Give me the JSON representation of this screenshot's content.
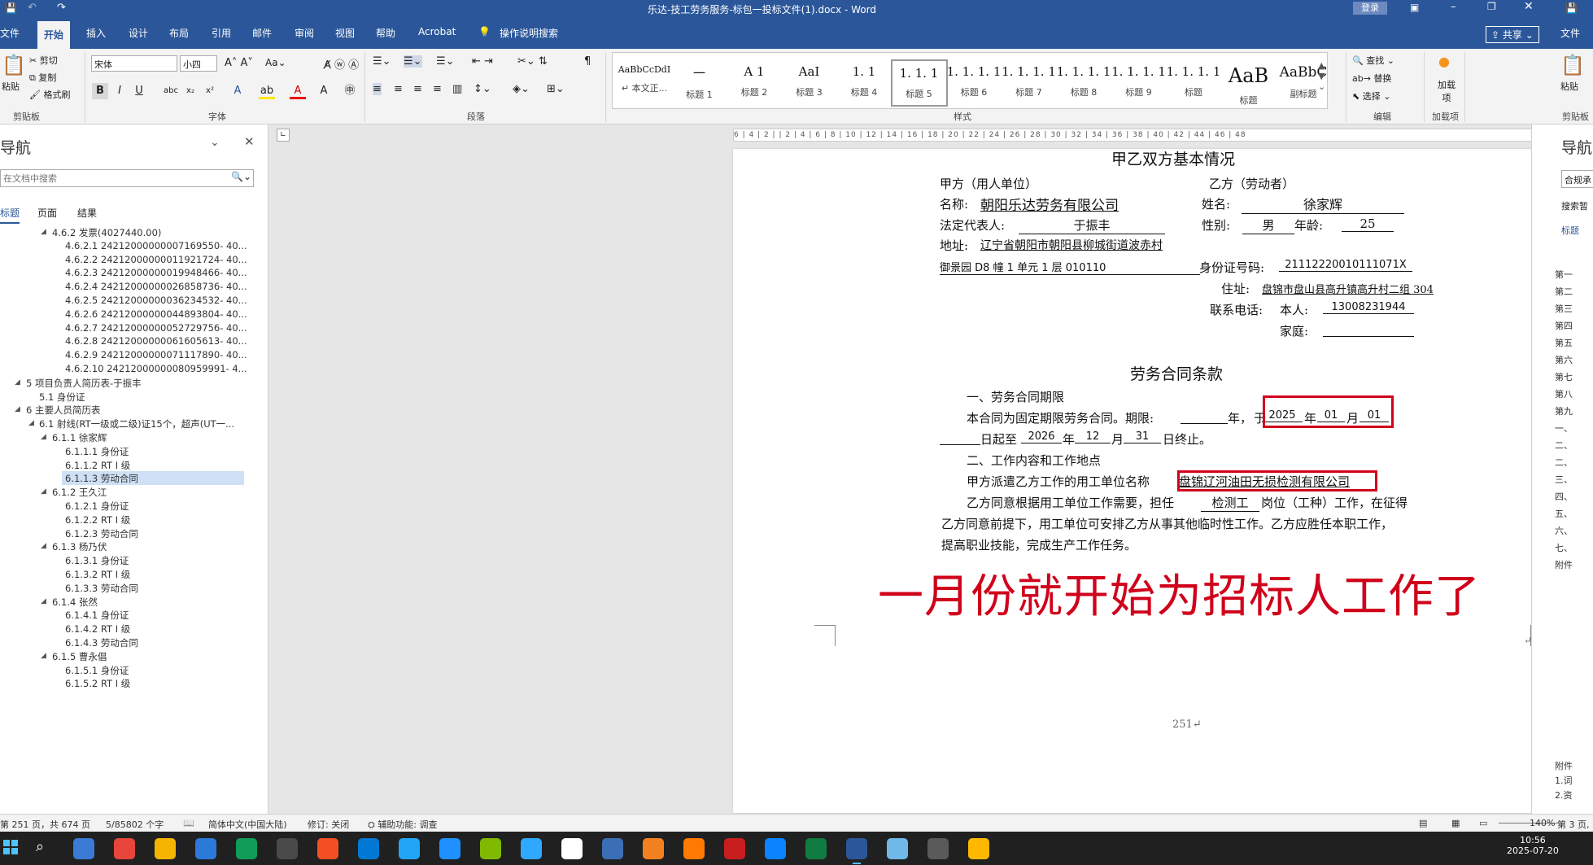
{
  "window": {
    "title": "乐达-技工劳务服务-标包一投标文件(1).docx  -  Word",
    "login": "登录",
    "share": "共享"
  },
  "tabs": [
    "文件",
    "开始",
    "插入",
    "设计",
    "布局",
    "引用",
    "邮件",
    "审阅",
    "视图",
    "帮助",
    "Acrobat"
  ],
  "search_tab": "操作说明搜索",
  "ribbon": {
    "clipboard": {
      "paste": "粘贴",
      "cut": "剪切",
      "copy": "复制",
      "format_painter": "格式刷",
      "group": "剪贴板"
    },
    "font": {
      "name": "宋体",
      "size": "小四",
      "group": "字体"
    },
    "paragraph": {
      "group": "段落"
    },
    "styles": {
      "group": "样式",
      "items": [
        {
          "preview": "AaBbCcDdI",
          "name": "↵ 本文正..."
        },
        {
          "preview": "一",
          "name": "标题 1"
        },
        {
          "preview": "A 1",
          "name": "标题 2"
        },
        {
          "preview": "AaI",
          "name": "标题 3"
        },
        {
          "preview": "1. 1",
          "name": "标题 4"
        },
        {
          "preview": "1. 1. 1",
          "name": "标题 5"
        },
        {
          "preview": "1. 1. 1. 1",
          "name": "标题 6"
        },
        {
          "preview": "1. 1. 1. 1",
          "name": "标题 7"
        },
        {
          "preview": "1. 1. 1. 1",
          "name": "标题 8"
        },
        {
          "preview": "1. 1. 1. 1",
          "name": "标题 9"
        },
        {
          "preview": "1. 1. 1. 1",
          "name": "标题"
        },
        {
          "preview": "AaB",
          "name": "标题"
        },
        {
          "preview": "AaBbC",
          "name": "副标题"
        }
      ]
    },
    "editing": {
      "find": "查找",
      "replace": "替换",
      "select": "选择",
      "group": "编辑"
    },
    "addins": {
      "label": "加载项",
      "group": "加载项"
    }
  },
  "nav": {
    "title": "导航",
    "search_placeholder": "在文档中搜索",
    "tabs": [
      "标题",
      "页面",
      "结果"
    ],
    "items": [
      {
        "text": "4.6.2 发票(4027440.00)",
        "level": 2,
        "tri": "◢"
      },
      {
        "text": "4.6.2.1 24212000000007169550- 40...",
        "level": 3
      },
      {
        "text": "4.6.2.2 24212000000011921724- 40...",
        "level": 3
      },
      {
        "text": "4.6.2.3 24212000000019948466- 40...",
        "level": 3
      },
      {
        "text": "4.6.2.4 24212000000026858736- 40...",
        "level": 3
      },
      {
        "text": "4.6.2.5 24212000000036234532- 40...",
        "level": 3
      },
      {
        "text": "4.6.2.6 24212000000044893804- 40...",
        "level": 3
      },
      {
        "text": "4.6.2.7 24212000000052729756- 40...",
        "level": 3
      },
      {
        "text": "4.6.2.8 24212000000061605613- 40...",
        "level": 3
      },
      {
        "text": "4.6.2.9 24212000000071117890- 40...",
        "level": 3
      },
      {
        "text": "4.6.2.10 24212000000080959991- 4...",
        "level": 3
      },
      {
        "text": "5 项目负责人简历表-于振丰",
        "level": 0,
        "tri": "◢"
      },
      {
        "text": "5.1 身份证",
        "level": 1
      },
      {
        "text": "6 主要人员简历表",
        "level": 0,
        "tri": "◢"
      },
      {
        "text": "6.1 射线(RT一级或二级)证15个，超声(UT一...",
        "level": 1,
        "tri": "◢"
      },
      {
        "text": "6.1.1 徐家辉",
        "level": 2,
        "tri": "◢"
      },
      {
        "text": "6.1.1.1 身份证",
        "level": 3
      },
      {
        "text": "6.1.1.2 RT I 级",
        "level": 3
      },
      {
        "text": "6.1.1.3 劳动合同",
        "level": 3,
        "selected": true
      },
      {
        "text": "6.1.2 王久江",
        "level": 2,
        "tri": "◢"
      },
      {
        "text": "6.1.2.1 身份证",
        "level": 3
      },
      {
        "text": "6.1.2.2 RT I 级",
        "level": 3
      },
      {
        "text": "6.1.2.3 劳动合同",
        "level": 3
      },
      {
        "text": "6.1.3 杨乃伏",
        "level": 2,
        "tri": "◢"
      },
      {
        "text": "6.1.3.1 身份证",
        "level": 3
      },
      {
        "text": "6.1.3.2 RT I 级",
        "level": 3
      },
      {
        "text": "6.1.3.3 劳动合同",
        "level": 3
      },
      {
        "text": "6.1.4 张然",
        "level": 2,
        "tri": "◢"
      },
      {
        "text": "6.1.4.1 身份证",
        "level": 3
      },
      {
        "text": "6.1.4.2 RT I 级",
        "level": 3
      },
      {
        "text": "6.1.4.3 劳动合同",
        "level": 3
      },
      {
        "text": "6.1.5 曹永倡",
        "level": 2,
        "tri": "◢"
      },
      {
        "text": "6.1.5.1 身份证",
        "level": 3
      },
      {
        "text": "6.1.5.2 RT I 级",
        "level": 3
      }
    ]
  },
  "ruler": "6 | 4 | 2 | | 2 | 4 | 6 | 8 | 10 | 12 | 14 | 16 | 18 | 20 | 22 | 24 | 26 | 28 | 30 | 32 | 34 | 36 | 38 | 40 | 42 | 44 | 46 | 48",
  "doc": {
    "heading1": "甲乙双方基本情况",
    "party_a": "甲方（用人单位）",
    "party_b": "乙方（劳动者）",
    "name_label": "名称:",
    "name_value": "朝阳乐达劳务有限公司",
    "b_name_label": "姓名:",
    "b_name_value": "徐家辉",
    "rep_label": "法定代表人:",
    "rep_value": "于振丰",
    "gender_label": "性别:",
    "gender_value": "男",
    "age_label": "年龄:",
    "age_value": "25",
    "addr_label": "地址:",
    "addr_value": "辽宁省朝阳市朝阳县柳城街道波赤村",
    "addr_line2": "御景园 D8 幢 1 单元 1 层 010110",
    "id_label": "身份证号码:",
    "id_value": "211122200101110​71X",
    "res_label": "住址:",
    "res_value": "盘锦市盘山县高升镇高升村二组 304",
    "phone_label": "联系电话:",
    "self_label": "本人:",
    "phone_value": "13008231944",
    "home_label": "家庭:",
    "heading2": "劳务合同条款",
    "sec1": "一、劳务合同期限",
    "term_line": "本合同为固定期限劳务合同。期限:",
    "year_char": "年，",
    "yu": "于",
    "start_year": "2025",
    "start_month": "01",
    "start_day": "01",
    "nian": "年",
    "yue": "月",
    "line_start_suffix": "日起至",
    "end_year": "2026",
    "end_month": "12",
    "end_day": "31",
    "end_suffix": "日终止。",
    "sec2": "二、工作内容和工作地点",
    "dispatch_line": "甲方派遣乙方工作的用工单位名称",
    "employer": "盘锦辽河油田无损检测有限公司",
    "agree_1": "乙方同意根据用工单位工作需要，担任",
    "job": "检测工",
    "agree_2": "岗位（工种）工作，在征得",
    "agree_line2": "乙方同意前提下，用工单位可安排乙方从事其他临时性工作。乙方应胜任本职工作，",
    "agree_line3": "提高职业技能，完成生产工作任务。",
    "annotation": "一月份就开始为招标人工作了",
    "page_num": "251↵"
  },
  "right_nav": {
    "title": "导航",
    "search": "合规承",
    "label": "搜索暂",
    "tab": "标题",
    "items": [
      "第一",
      "第二",
      "第三",
      "第四",
      "第五",
      "第六",
      "第七",
      "第八",
      "第九",
      "一、",
      "二、",
      "二、",
      "三、",
      "四、",
      "五、",
      "六、",
      "七、",
      "附件",
      "附件",
      "1.词",
      "2.资"
    ]
  },
  "status": {
    "page": "第 251 页，共 674 页",
    "words": "5/85802 个字",
    "lang": "简体中文(中国大陆)",
    "track": "修订: 关闭",
    "access": "辅助功能: 调查",
    "zoom": "140%",
    "right": "第 3 页,"
  },
  "clock": {
    "time": "10:56",
    "date": "2025-07-20"
  },
  "colors": {
    "brand": "#2b579a",
    "annotation": "#d0021b"
  }
}
